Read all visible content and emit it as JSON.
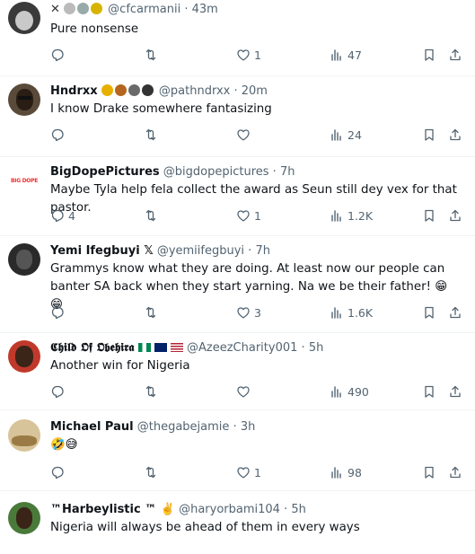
{
  "tweets": [
    {
      "name": "",
      "handle": "@cfcarmanii",
      "time": "43m",
      "text": "Pure nonsense",
      "replies": "",
      "retweets": "",
      "likes": "1",
      "views": "47"
    },
    {
      "name": "Hndrxx",
      "handle": "@pathndrxx",
      "time": "20m",
      "text": "I know Drake somewhere fantasizing",
      "replies": "",
      "retweets": "",
      "likes": "",
      "views": "24"
    },
    {
      "name": "BigDopePictures",
      "handle": "@bigdopepictures",
      "time": "7h",
      "text": "Maybe Tyla help fela collect the award as Seun still dey vex for that pastor.",
      "replies": "4",
      "retweets": "",
      "likes": "1",
      "views": "1.2K",
      "avatar_text": "BIG DOPE"
    },
    {
      "name": "Yemi Ifegbuyi 𝕏",
      "handle": "@yemiifegbuyi",
      "time": "7h",
      "text": "Grammys know what they are doing. At least now our people  can banter SA back when they start yarning. Na we be their father! 😁😁",
      "replies": "",
      "retweets": "",
      "likes": "3",
      "views": "1.6K"
    },
    {
      "name": "𝕮𝖍𝖎𝖑𝖉 𝕺𝖋 𝕺𝖇𝖊𝖍𝖎𝖗𝖆",
      "handle": "@AzeezCharity001",
      "time": "5h",
      "text": "Another win for Nigeria",
      "replies": "",
      "retweets": "",
      "likes": "",
      "views": "490"
    },
    {
      "name": "Michael Paul",
      "handle": "@thegabejamie",
      "time": "3h",
      "text": "🤣😅",
      "replies": "",
      "retweets": "",
      "likes": "1",
      "views": "98"
    },
    {
      "name": "™Harbeylistic ™ ✌️",
      "handle": "@haryorbami104",
      "time": "5h",
      "text": "Nigeria will always be ahead of them in every ways",
      "replies": "",
      "retweets": "",
      "likes": "",
      "views": ""
    }
  ],
  "separator": "·",
  "colors": {
    "text": "#0f1419",
    "muted": "#536471",
    "border": "#eff3f4"
  }
}
